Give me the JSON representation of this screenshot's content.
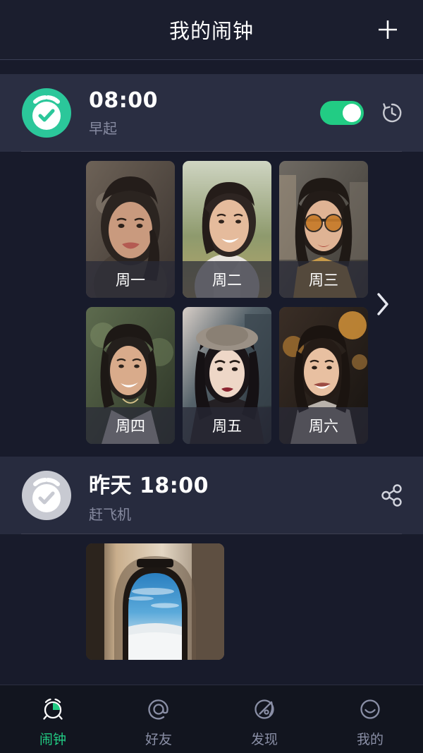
{
  "header": {
    "title": "我的闹钟",
    "add_label": "+"
  },
  "alarms": [
    {
      "time": "08:00",
      "label": "早起",
      "enabled": true,
      "toggle_state": "on",
      "trailing_icon": "history-icon",
      "accent_color": "#22cc84"
    },
    {
      "time": "昨天 18:00",
      "label": "赶飞机",
      "enabled": false,
      "trailing_icon": "share-icon",
      "accent_color": "#c8cad2"
    }
  ],
  "day_cards": {
    "rows": [
      [
        {
          "day": "周一"
        },
        {
          "day": "周二"
        },
        {
          "day": "周三"
        }
      ],
      [
        {
          "day": "周四"
        },
        {
          "day": "周五"
        },
        {
          "day": "周六"
        }
      ]
    ],
    "next_arrow": "chevron-right-icon"
  },
  "flight_photo": {
    "alt": "airplane-window-view"
  },
  "tabbar": {
    "items": [
      {
        "label": "闹钟",
        "icon": "alarm-clock-icon",
        "active": true
      },
      {
        "label": "好友",
        "icon": "at-sign-icon",
        "active": false
      },
      {
        "label": "发现",
        "icon": "compass-icon",
        "active": false
      },
      {
        "label": "我的",
        "icon": "smiley-face-icon",
        "active": false
      }
    ],
    "active_color": "#22cc84",
    "inactive_color": "#8a8fa6"
  }
}
